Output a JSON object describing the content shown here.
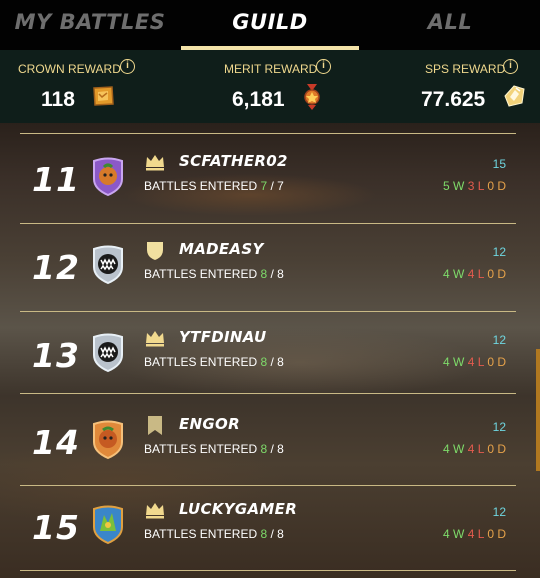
{
  "tabs": [
    {
      "label": "MY BATTLES"
    },
    {
      "label": "GUILD"
    },
    {
      "label": "ALL"
    }
  ],
  "rewards": {
    "crown": {
      "label": "CROWN REWARD",
      "value": "118",
      "icon": "crown-token-icon"
    },
    "merit": {
      "label": "MERIT REWARD",
      "value": "6,181",
      "icon": "merit-medal-icon"
    },
    "sps": {
      "label": "SPS REWARD",
      "value": "77.625",
      "icon": "sps-token-icon"
    },
    "info_glyph": "i"
  },
  "battles_label": "BATTLES ENTERED",
  "rows": [
    {
      "rank": "11",
      "name": "SCFATHER02",
      "league": "crown",
      "avatar": "purple-fruit-avatar",
      "entered": "7",
      "total": "/ 7",
      "points": "15",
      "w": "5 W",
      "l": "3 L",
      "d": "0 D"
    },
    {
      "rank": "12",
      "name": "MADEASY",
      "league": "shield",
      "avatar": "monster-mouth-avatar",
      "entered": "8",
      "total": "/ 8",
      "points": "12",
      "w": "4 W",
      "l": "4 L",
      "d": "0 D"
    },
    {
      "rank": "13",
      "name": "YTFDINAU",
      "league": "crown",
      "avatar": "monster-mouth-avatar",
      "entered": "8",
      "total": "/ 8",
      "points": "12",
      "w": "4 W",
      "l": "4 L",
      "d": "0 D"
    },
    {
      "rank": "14",
      "name": "ENGOR",
      "league": "banner",
      "avatar": "orange-fruit-avatar",
      "entered": "8",
      "total": "/ 8",
      "points": "12",
      "w": "4 W",
      "l": "4 L",
      "d": "0 D"
    },
    {
      "rank": "15",
      "name": "LUCKYGAMER",
      "league": "crown",
      "avatar": "blue-dragon-avatar",
      "entered": "8",
      "total": "/ 8",
      "points": "12",
      "w": "4 W",
      "l": "4 L",
      "d": "0 D"
    }
  ],
  "colors": {
    "accent": "#f3e3a8",
    "reward_label": "#efd88e",
    "win": "#7edb6a",
    "loss": "#e35b4e",
    "draw": "#e6a24a",
    "points": "#6fd6e0"
  }
}
